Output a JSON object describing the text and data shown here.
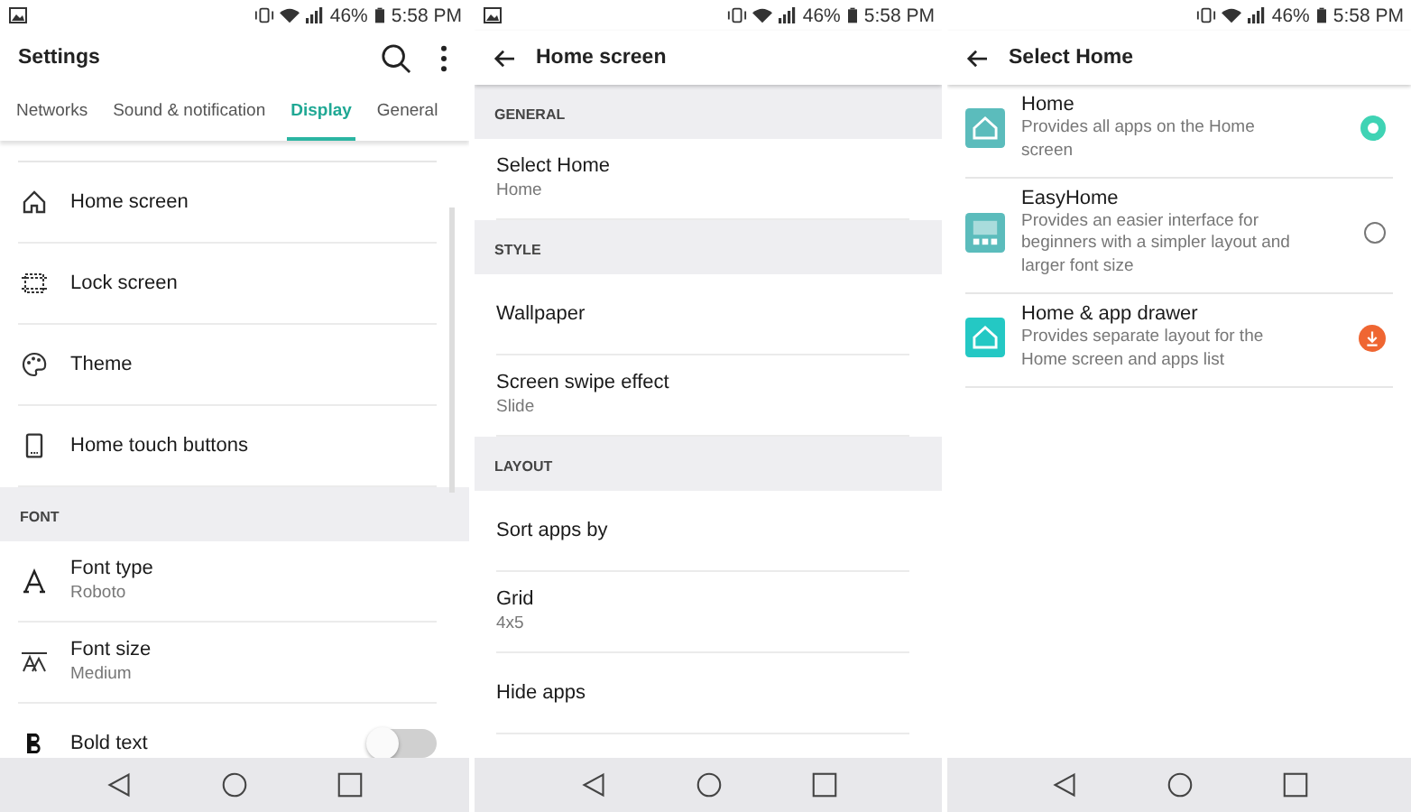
{
  "screens": [
    {
      "status": {
        "notification_icon": true,
        "battery": "46%",
        "time": "5:58 PM"
      },
      "title": "Settings",
      "back": false,
      "actions": true,
      "tabs": [
        {
          "label": "Networks",
          "selected": false
        },
        {
          "label": "Sound & notification",
          "selected": false
        },
        {
          "label": "Display",
          "selected": true
        },
        {
          "label": "General",
          "selected": false
        }
      ],
      "rows": [
        {
          "kind": "item",
          "label": "Home screen"
        },
        {
          "kind": "item",
          "label": "Lock screen"
        },
        {
          "kind": "item",
          "label": "Theme"
        },
        {
          "kind": "item",
          "label": "Home touch buttons"
        },
        {
          "kind": "header",
          "label": "FONT"
        },
        {
          "kind": "item",
          "label": "Font type",
          "value": "Roboto"
        },
        {
          "kind": "item",
          "label": "Font size",
          "value": "Medium"
        },
        {
          "kind": "toggle",
          "label": "Bold text",
          "on": false
        }
      ]
    },
    {
      "status": {
        "notification_icon": true,
        "battery": "46%",
        "time": "5:58 PM"
      },
      "title": "Home screen",
      "back": true,
      "actions": false,
      "rows": [
        {
          "kind": "header",
          "label": "GENERAL"
        },
        {
          "kind": "item",
          "label": "Select Home",
          "value": "Home"
        },
        {
          "kind": "header",
          "label": "STYLE"
        },
        {
          "kind": "item",
          "label": "Wallpaper"
        },
        {
          "kind": "item",
          "label": "Screen swipe effect",
          "value": "Slide"
        },
        {
          "kind": "header",
          "label": "LAYOUT"
        },
        {
          "kind": "item",
          "label": "Sort apps by"
        },
        {
          "kind": "item",
          "label": "Grid",
          "value": "4x5"
        },
        {
          "kind": "item",
          "label": "Hide apps"
        }
      ]
    },
    {
      "status": {
        "notification_icon": false,
        "battery": "46%",
        "time": "5:58 PM"
      },
      "title": "Select Home",
      "back": true,
      "actions": false,
      "rows": [
        {
          "kind": "radio",
          "label": "Home",
          "value": "Provides all apps on the Home screen",
          "selected": true
        },
        {
          "kind": "radio",
          "label": "EasyHome",
          "value": "Provides an easier interface for beginners with a simpler layout and larger font size",
          "selected": false
        },
        {
          "kind": "download",
          "label": "Home & app drawer",
          "value": "Provides separate layout for the Home screen and apps list"
        }
      ]
    }
  ]
}
